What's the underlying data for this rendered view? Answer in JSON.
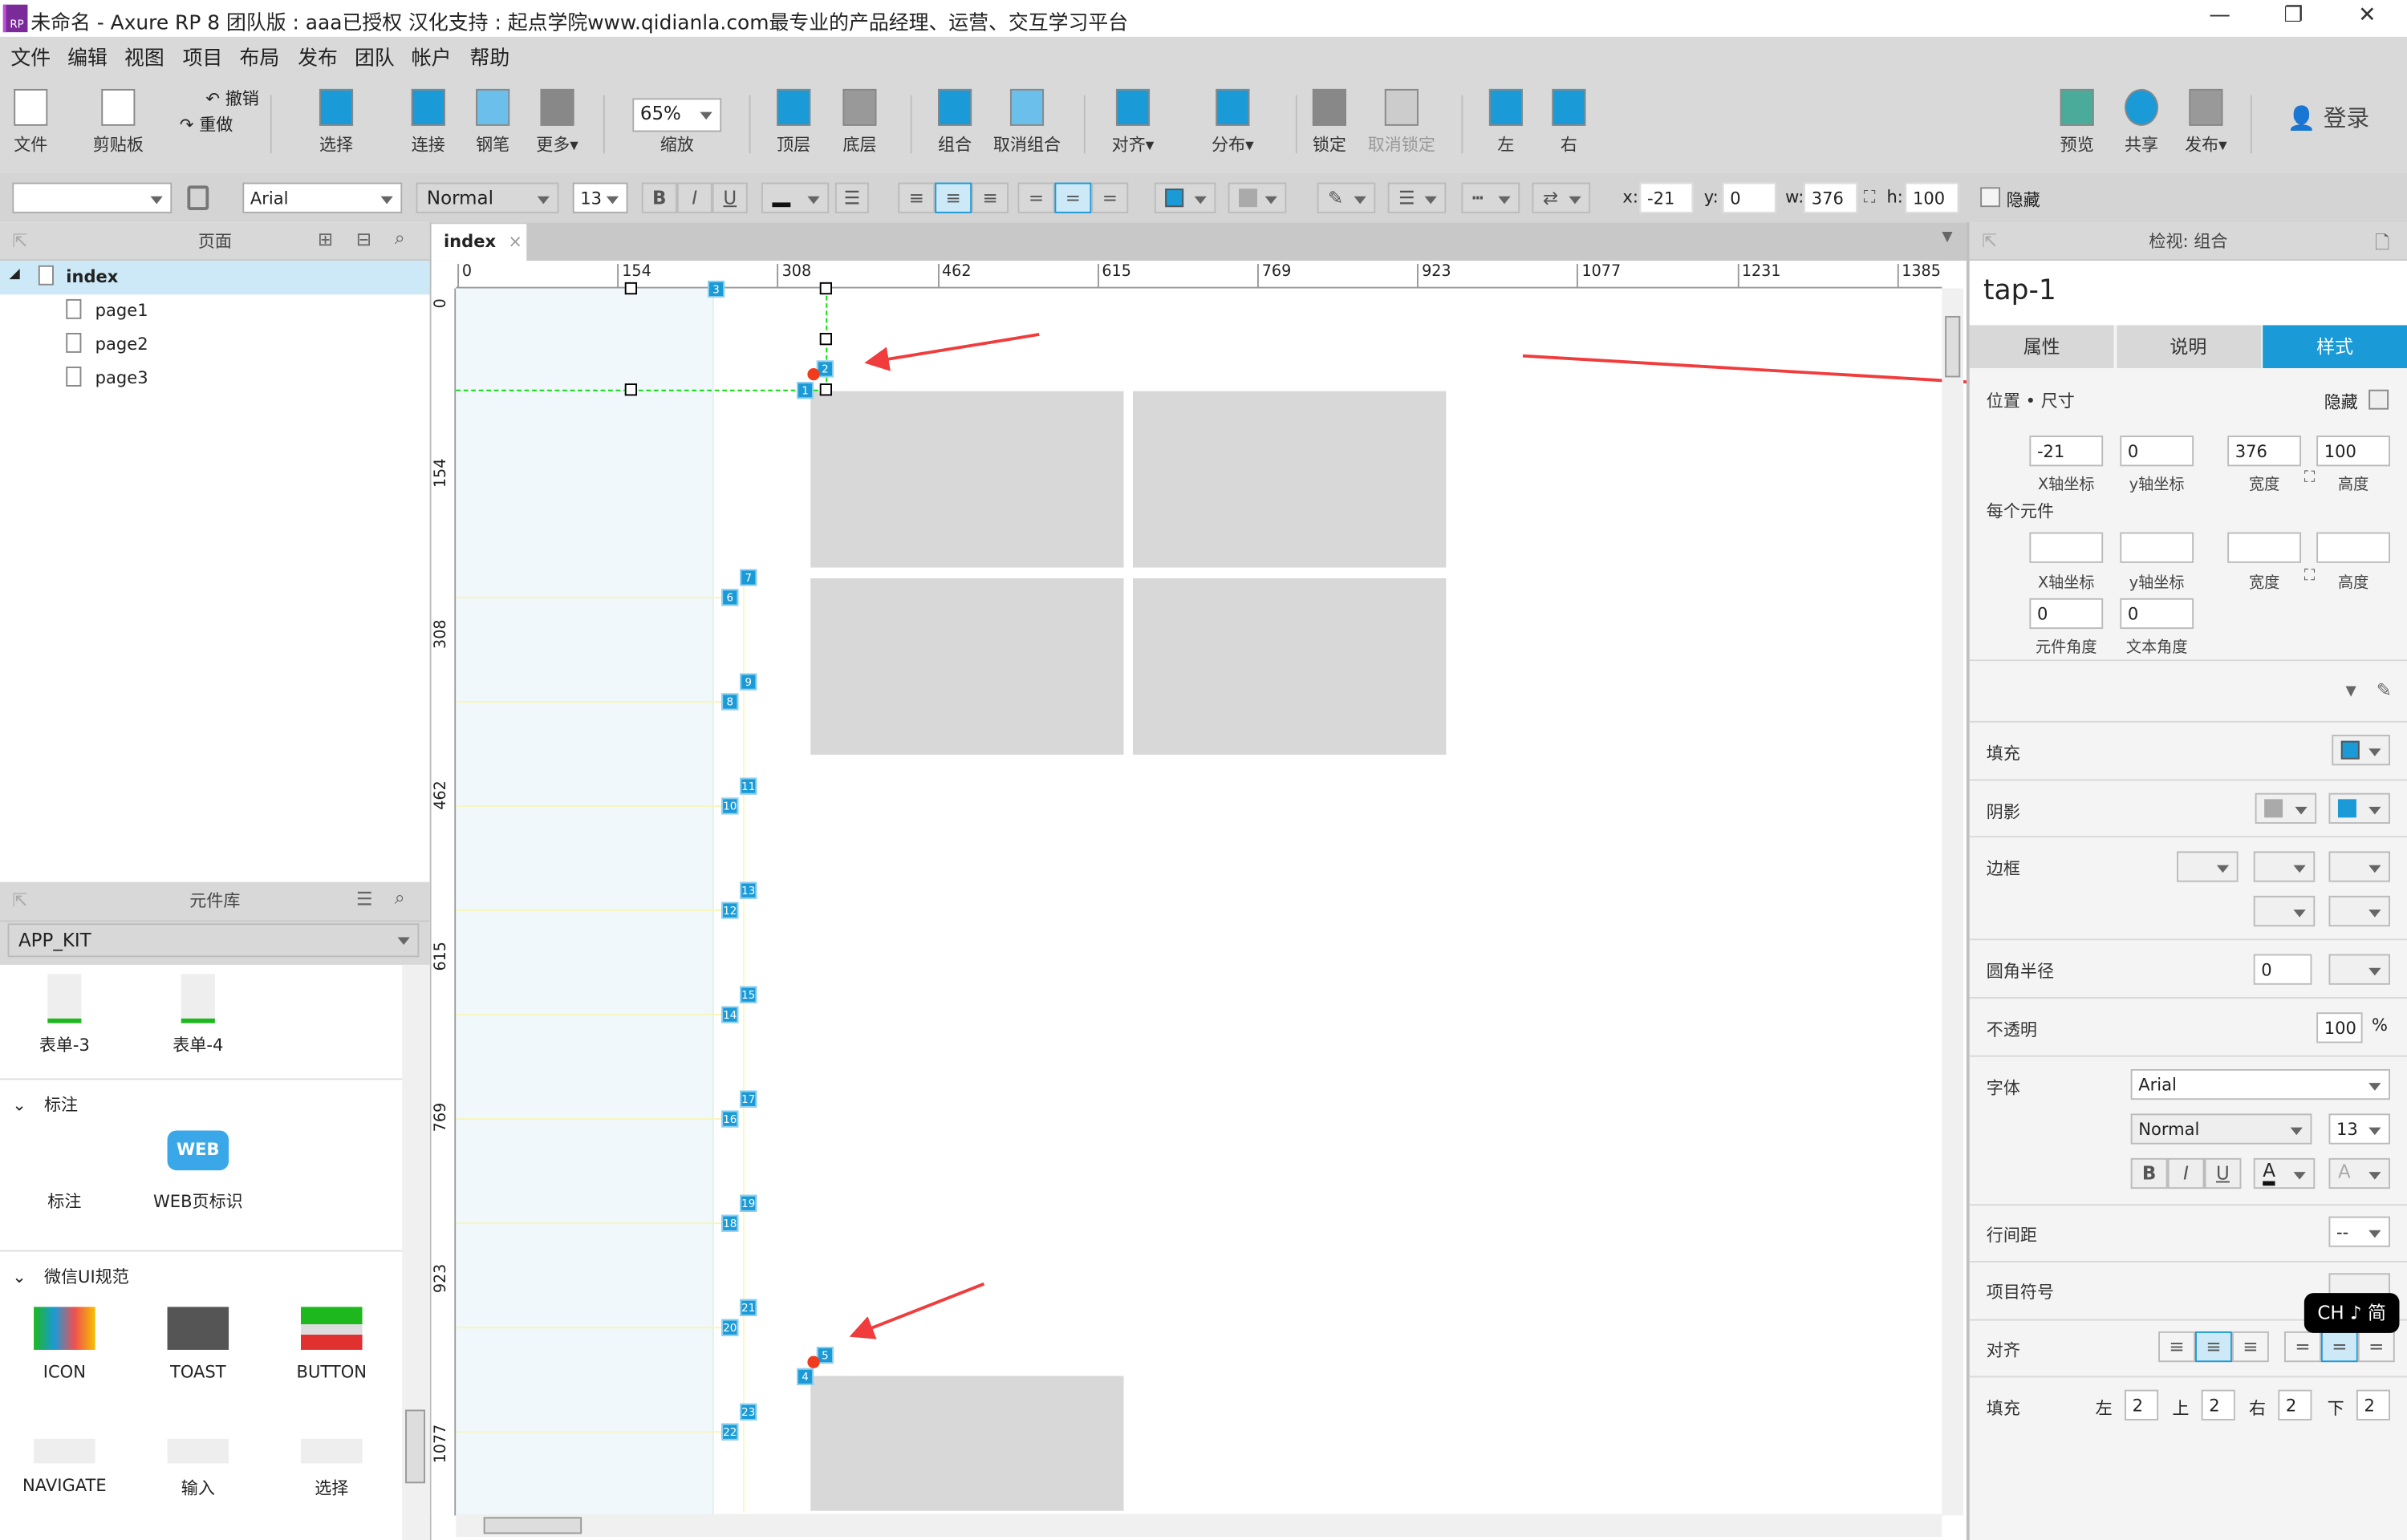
{
  "window": {
    "title": "未命名 - Axure RP 8 团队版 : aaa已授权 汉化支持 : 起点学院www.qidianla.com最专业的产品经理、运营、交互学习平台",
    "logo": "RP",
    "minimize": "—",
    "restore": "❐",
    "close": "✕"
  },
  "menu": [
    "文件",
    "编辑",
    "视图",
    "项目",
    "布局",
    "发布",
    "团队",
    "帐户",
    "帮助"
  ],
  "toolbar": {
    "file": "文件",
    "clipboard": "剪贴板",
    "undo": "撤销",
    "redo": "重做",
    "select": "选择",
    "connect": "连接",
    "pen": "钢笔",
    "more": "更多▾",
    "zoom_value": "65%",
    "zoom": "缩放",
    "front": "顶层",
    "back": "底层",
    "group": "组合",
    "ungroup": "取消组合",
    "align": "对齐▾",
    "distribute": "分布▾",
    "lock": "锁定",
    "unlock": "取消锁定",
    "left": "左",
    "right": "右",
    "preview": "预览",
    "share": "共享",
    "publish": "发布▾",
    "login": "登录"
  },
  "format": {
    "style_value": "",
    "font": "Arial",
    "weight": "Normal",
    "size": "13",
    "bold": "B",
    "italic": "I",
    "underline": "U",
    "x_label": "x:",
    "x": "-21",
    "y_label": "y:",
    "y": "0",
    "w_label": "w:",
    "w": "376",
    "h_label": "h:",
    "h": "100",
    "hidden_label": "隐藏",
    "fill_color": "#1a9ad6"
  },
  "pages": {
    "title": "页面",
    "items": [
      {
        "label": "index",
        "selected": true
      },
      {
        "label": "page1"
      },
      {
        "label": "page2"
      },
      {
        "label": "page3"
      }
    ]
  },
  "library": {
    "title": "元件库",
    "selected": "APP_KIT",
    "top_items": [
      "表单-3",
      "表单-4"
    ],
    "sections": [
      {
        "title": "标注",
        "items": [
          "标注",
          "WEB页标识"
        ]
      },
      {
        "title": "微信UI规范",
        "items": [
          "ICON",
          "TOAST",
          "BUTTON",
          "NAVIGATE",
          "输入",
          "选择"
        ]
      }
    ],
    "web_badge": "WEB"
  },
  "canvas": {
    "tab": "index",
    "tab_close": "×",
    "ruler_x": [
      "0",
      "154",
      "308",
      "462",
      "615",
      "769",
      "923",
      "1077",
      "1231",
      "1385"
    ],
    "ruler_y": [
      "0",
      "154",
      "308",
      "462",
      "615",
      "769",
      "923",
      "1077"
    ],
    "markers": [
      "1",
      "2",
      "3",
      "4",
      "5",
      "6",
      "7",
      "8",
      "9",
      "10",
      "11",
      "12",
      "13",
      "14",
      "15",
      "16",
      "17",
      "18",
      "19",
      "20",
      "21",
      "22",
      "23"
    ],
    "annotation_color": "#f03c3c",
    "guide_color": "#00e000"
  },
  "inspector": {
    "title": "检视: 组合",
    "name": "tap-1",
    "tabs": [
      "属性",
      "说明",
      "样式"
    ],
    "active_tab": "样式",
    "position_size": "位置 • 尺寸",
    "hidden": "隐藏",
    "x": "-21",
    "y": "0",
    "w": "376",
    "h": "100",
    "x_label": "X轴坐标",
    "y_label": "y轴坐标",
    "w_label": "宽度",
    "h_label": "高度",
    "per_widget": "每个元件",
    "rotation": "0",
    "text_rotation": "0",
    "rotation_label": "元件角度",
    "text_rotation_label": "文本角度",
    "fill": "填充",
    "shadow": "阴影",
    "border": "边框",
    "radius": "圆角半径",
    "radius_value": "0",
    "opacity": "不透明",
    "opacity_value": "100",
    "percent": "%",
    "font": "字体",
    "font_value": "Arial",
    "weight_value": "Normal",
    "size_value": "13",
    "line_spacing": "行间距",
    "line_spacing_value": "--",
    "bullets": "项目符号",
    "align": "对齐",
    "padding": "填充",
    "pad_left_label": "左",
    "pad_left": "2",
    "pad_top_label": "上",
    "pad_top": "2",
    "pad_right_label": "右",
    "pad_right": "2",
    "pad_bottom_label": "下",
    "pad_bottom": "2"
  },
  "ime": "CH ♪ 简"
}
